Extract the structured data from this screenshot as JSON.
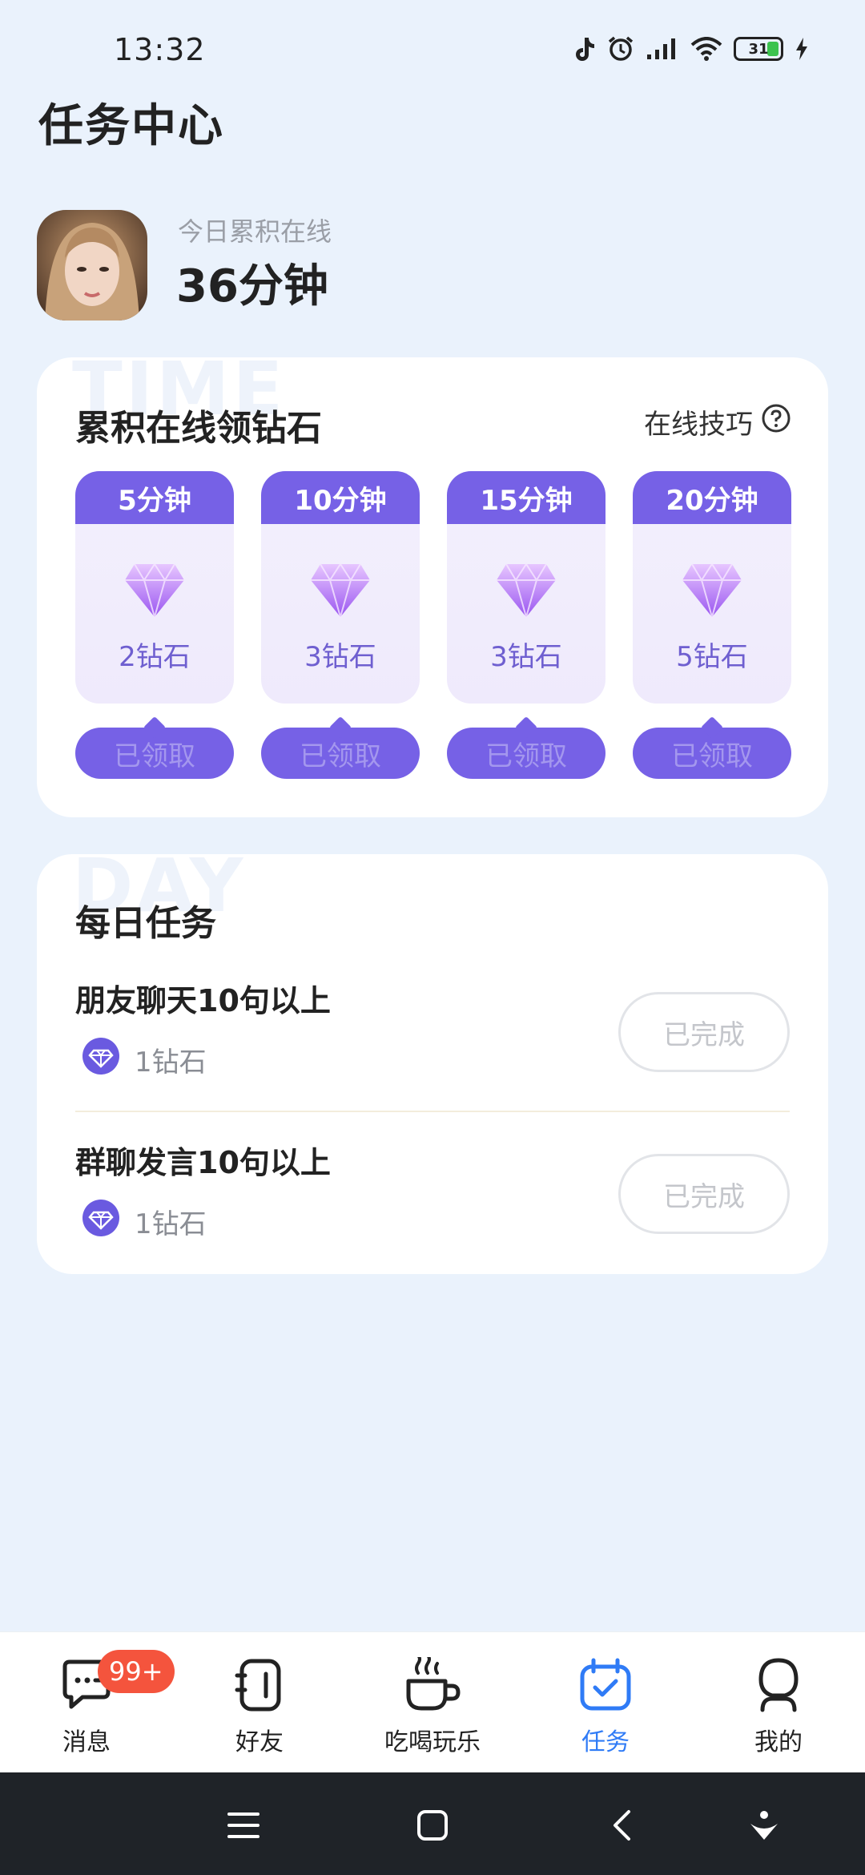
{
  "status_bar": {
    "time": "13:32",
    "battery": "31",
    "icons": [
      "tiktok-icon",
      "alarm-icon",
      "signal-icon",
      "wifi-icon",
      "battery-icon",
      "charging-icon"
    ]
  },
  "page": {
    "title": "任务中心"
  },
  "profile": {
    "online_label": "今日累积在线",
    "online_value": "36分钟"
  },
  "online_card": {
    "watermark": "TIME",
    "title": "累积在线领钻石",
    "tips_label": "在线技巧",
    "rewards": [
      {
        "duration": "5分钟",
        "amount": "2钻石",
        "button": "已领取"
      },
      {
        "duration": "10分钟",
        "amount": "3钻石",
        "button": "已领取"
      },
      {
        "duration": "15分钟",
        "amount": "3钻石",
        "button": "已领取"
      },
      {
        "duration": "20分钟",
        "amount": "5钻石",
        "button": "已领取"
      }
    ]
  },
  "daily_card": {
    "watermark": "DAY",
    "title": "每日任务",
    "tasks": [
      {
        "name": "朋友聊天10句以上",
        "reward": "1钻石",
        "button": "已完成"
      },
      {
        "name": "群聊发言10句以上",
        "reward": "1钻石",
        "button": "已完成"
      }
    ]
  },
  "tab_bar": {
    "tabs": [
      {
        "label": "消息",
        "icon": "chat-icon",
        "badge": "99+"
      },
      {
        "label": "好友",
        "icon": "contacts-icon"
      },
      {
        "label": "吃喝玩乐",
        "icon": "coffee-cup-icon"
      },
      {
        "label": "任务",
        "icon": "task-calendar-icon",
        "active": true
      },
      {
        "label": "我的",
        "icon": "profile-icon"
      }
    ]
  },
  "colors": {
    "accent_purple": "#7661e6",
    "active_tab_blue": "#2f7bf6",
    "badge_red": "#f4543d",
    "page_background": "#eaf2fc"
  }
}
